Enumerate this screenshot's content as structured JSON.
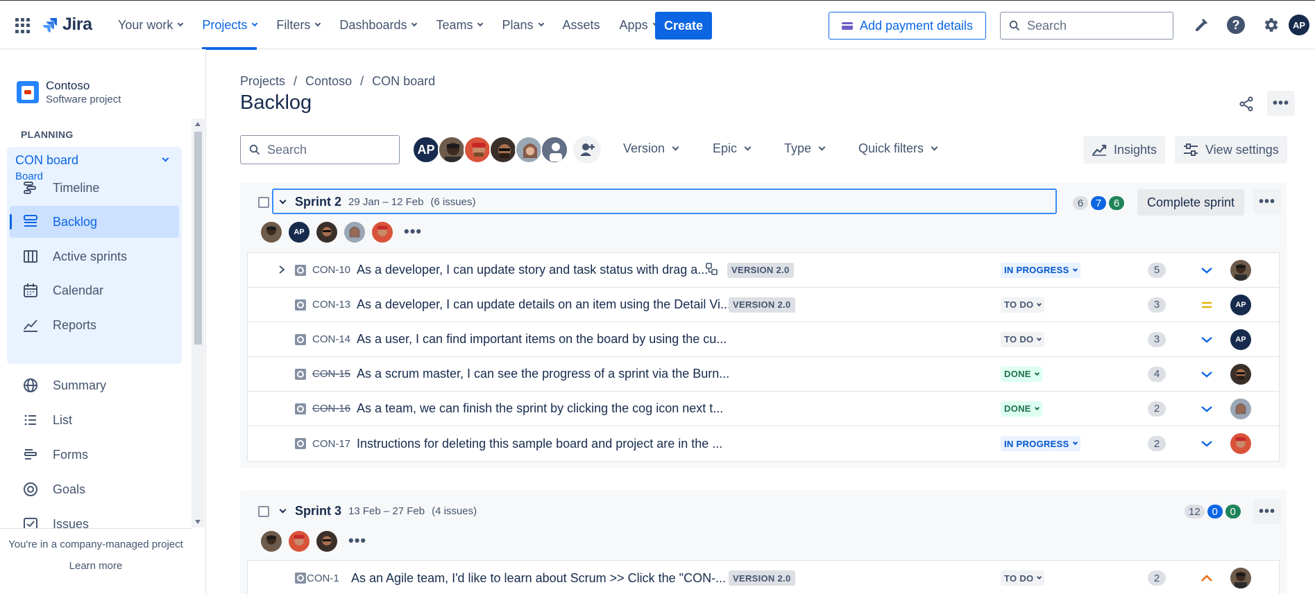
{
  "topnav": {
    "logo_text": "Jira",
    "items": [
      {
        "label": "Your work",
        "has_dropdown": true,
        "active": false
      },
      {
        "label": "Projects",
        "has_dropdown": true,
        "active": true
      },
      {
        "label": "Filters",
        "has_dropdown": true,
        "active": false
      },
      {
        "label": "Dashboards",
        "has_dropdown": true,
        "active": false
      },
      {
        "label": "Teams",
        "has_dropdown": true,
        "active": false
      },
      {
        "label": "Plans",
        "has_dropdown": true,
        "active": false
      },
      {
        "label": "Assets",
        "has_dropdown": false,
        "active": false
      },
      {
        "label": "Apps",
        "has_dropdown": true,
        "active": false
      }
    ],
    "create_label": "Create",
    "payment_label": "Add payment details",
    "search_placeholder": "Search",
    "user_initials": "AP"
  },
  "sidebar": {
    "project_name": "Contoso",
    "project_type": "Software project",
    "section_planning": "PLANNING",
    "board_name": "CON board",
    "board_sub": "Board",
    "planning_items": [
      {
        "label": "Timeline",
        "icon": "timeline-icon"
      },
      {
        "label": "Backlog",
        "icon": "backlog-icon",
        "active": true
      },
      {
        "label": "Active sprints",
        "icon": "active-sprints-icon"
      },
      {
        "label": "Calendar",
        "icon": "calendar-icon"
      },
      {
        "label": "Reports",
        "icon": "reports-icon"
      }
    ],
    "other_items": [
      {
        "label": "Summary",
        "icon": "globe-icon"
      },
      {
        "label": "List",
        "icon": "list-icon"
      },
      {
        "label": "Forms",
        "icon": "forms-icon"
      },
      {
        "label": "Goals",
        "icon": "goals-icon"
      },
      {
        "label": "Issues",
        "icon": "issues-icon"
      }
    ],
    "footer_note": "You're in a company-managed project",
    "learn_more": "Learn more"
  },
  "main": {
    "breadcrumbs": [
      "Projects",
      "Contoso",
      "CON board"
    ],
    "title": "Backlog",
    "search_placeholder": "Search",
    "filters": [
      "Version",
      "Epic",
      "Type",
      "Quick filters"
    ],
    "insights_label": "Insights",
    "view_settings_label": "View settings",
    "filter_avatar_initials": "AP"
  },
  "sprints": [
    {
      "name": "Sprint 2",
      "dates": "29 Jan – 12 Feb",
      "count": "(6 issues)",
      "counts": {
        "todo": "6",
        "in_progress": "7",
        "done": "6"
      },
      "action_label": "Complete sprint",
      "issues": [
        {
          "key": "CON-10",
          "summary": "As a developer, I can update story and task status with drag a...",
          "version": "VERSION 2.0",
          "status": "IN PROGRESS",
          "points": "5",
          "priority": "low",
          "has_children": true,
          "done": false
        },
        {
          "key": "CON-13",
          "summary": "As a developer, I can update details on an item using the Detail Vi...",
          "version": "VERSION 2.0",
          "status": "TO DO",
          "points": "3",
          "priority": "medium",
          "has_children": false,
          "done": false
        },
        {
          "key": "CON-14",
          "summary": "As a user, I can find important items on the board by using the cu...",
          "version": "",
          "status": "TO DO",
          "points": "3",
          "priority": "low",
          "has_children": false,
          "done": false
        },
        {
          "key": "CON-15",
          "summary": "As a scrum master, I can see the progress of a sprint via the Burn...",
          "version": "",
          "status": "DONE",
          "points": "4",
          "priority": "low",
          "has_children": false,
          "done": true
        },
        {
          "key": "CON-16",
          "summary": "As a team, we can finish the sprint by clicking the cog icon next t...",
          "version": "",
          "status": "DONE",
          "points": "2",
          "priority": "low",
          "has_children": false,
          "done": true
        },
        {
          "key": "CON-17",
          "summary": "Instructions for deleting this sample board and project are in the ...",
          "version": "",
          "status": "IN PROGRESS",
          "points": "2",
          "priority": "low",
          "has_children": false,
          "done": false
        }
      ]
    },
    {
      "name": "Sprint 3",
      "dates": "13 Feb – 27 Feb",
      "count": "(4 issues)",
      "counts": {
        "todo": "12",
        "in_progress": "0",
        "done": "0"
      },
      "issues": [
        {
          "key": "CON-1",
          "summary": "As an Agile team, I'd like to learn about Scrum >> Click the \"CON-...",
          "version": "VERSION 2.0",
          "status": "TO DO",
          "points": "2",
          "priority": "high",
          "has_children": false,
          "done": false
        }
      ]
    }
  ],
  "colors": {
    "accent": "#0c66e4",
    "done_green": "#1f845a",
    "priority_medium": "#e2b203",
    "priority_high": "#e56910"
  }
}
